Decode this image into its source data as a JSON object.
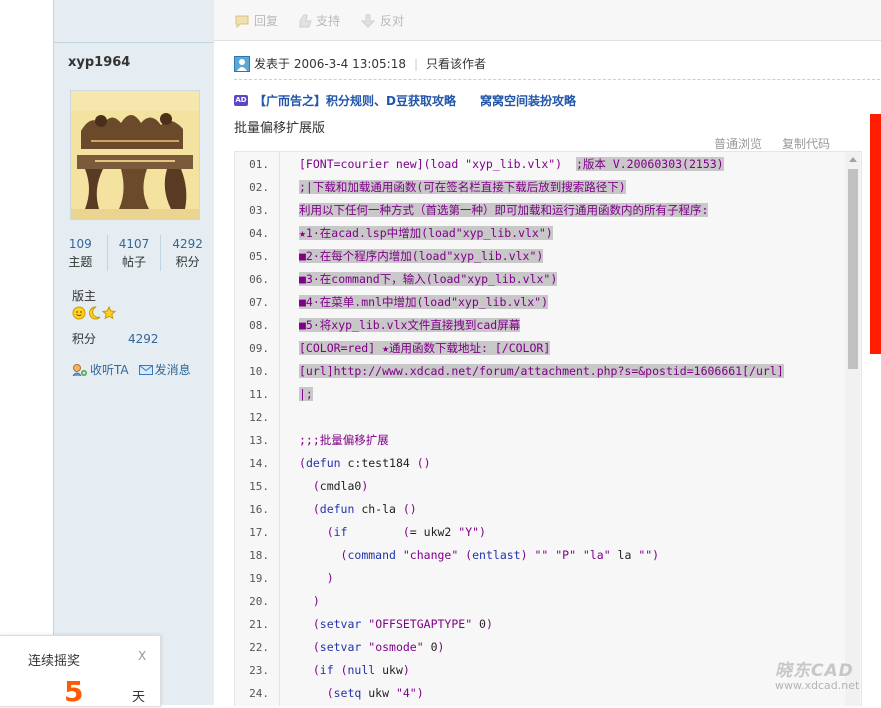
{
  "actions": {
    "reply": "回复",
    "support": "支持",
    "oppose": "反对"
  },
  "user": {
    "name": "xyp1964",
    "stats": [
      {
        "num": "109",
        "label": "主题"
      },
      {
        "num": "4107",
        "label": "帖子"
      },
      {
        "num": "4292",
        "label": "积分"
      }
    ],
    "rank": "版主",
    "credit_label": "积分",
    "credit_value": "4292",
    "listen": "收听TA",
    "message": "发消息"
  },
  "post": {
    "posted": "发表于 2006-3-4 13:05:18",
    "only_author": "只看该作者",
    "ad_badge": "AD",
    "ad_link1": "【广而告之】积分规则、D豆获取攻略",
    "ad_link2": "窝窝空间装扮攻略",
    "title": "批量偏移扩展版"
  },
  "code": {
    "view_plain": "普通浏览",
    "copy_code": "复制代码",
    "lines": [
      {
        "n": "01.",
        "segs": [
          {
            "t": "[FONT=courier new](load \"xyp_lib.vlx\")",
            "c": "purple"
          },
          {
            "t": "  ",
            "c": "black"
          },
          {
            "t": ";版本 V.20060303(2153)",
            "c": "purple",
            "hl": true
          }
        ]
      },
      {
        "n": "02.",
        "segs": [
          {
            "t": ";|下载和加载通用函数(可在签名栏直接下载后放到搜索路径下)",
            "c": "purple",
            "hl": true
          }
        ]
      },
      {
        "n": "03.",
        "segs": [
          {
            "t": "利用以下任何一种方式（首选第一种）即可加载和运行通用函数内的所有子程序:",
            "c": "purple",
            "hl": true
          }
        ]
      },
      {
        "n": "04.",
        "segs": [
          {
            "t": "★1·在acad.lsp中增加(load\"xyp_lib.vlx\")",
            "c": "purple",
            "hl": true
          }
        ]
      },
      {
        "n": "05.",
        "segs": [
          {
            "t": "■2·在每个程序内增加(load\"xyp_lib.vlx\")",
            "c": "purple",
            "hl": true
          }
        ]
      },
      {
        "n": "06.",
        "segs": [
          {
            "t": "■3·在command下，输入(load\"xyp_lib.vlx\")",
            "c": "purple",
            "hl": true
          }
        ]
      },
      {
        "n": "07.",
        "segs": [
          {
            "t": "■4·在菜单.mnl中增加(load\"xyp_lib.vlx\")",
            "c": "purple",
            "hl": true
          }
        ]
      },
      {
        "n": "08.",
        "segs": [
          {
            "t": "■5·将xyp_lib.vlx文件直接拽到cad屏幕",
            "c": "purple",
            "hl": true
          }
        ]
      },
      {
        "n": "09.",
        "segs": [
          {
            "t": "[COLOR=red] ★通用函数下载地址: [/COLOR]",
            "c": "purple",
            "hl": true
          }
        ]
      },
      {
        "n": "10.",
        "segs": [
          {
            "t": "[url]http://www.xdcad.net/forum/attachment.php?s=&postid=1606661[/url]",
            "c": "purple",
            "hl": true
          }
        ]
      },
      {
        "n": "11.",
        "segs": [
          {
            "t": "|;",
            "c": "purple",
            "hl": true
          }
        ]
      },
      {
        "n": "12.",
        "segs": []
      },
      {
        "n": "13.",
        "segs": [
          {
            "t": ";;;批量偏移扩展",
            "c": "purple"
          }
        ]
      },
      {
        "n": "14.",
        "segs": [
          {
            "t": "(",
            "c": "purple"
          },
          {
            "t": "defun",
            "c": "blue"
          },
          {
            "t": " c:test184 ",
            "c": "black"
          },
          {
            "t": "()",
            "c": "purple"
          }
        ]
      },
      {
        "n": "15.",
        "segs": [
          {
            "t": "  (",
            "c": "purple"
          },
          {
            "t": "cmdla0",
            "c": "black"
          },
          {
            "t": ")",
            "c": "purple"
          }
        ]
      },
      {
        "n": "16.",
        "segs": [
          {
            "t": "  (",
            "c": "purple"
          },
          {
            "t": "defun",
            "c": "blue"
          },
          {
            "t": " ch-la ",
            "c": "black"
          },
          {
            "t": "()",
            "c": "purple"
          }
        ]
      },
      {
        "n": "17.",
        "segs": [
          {
            "t": "    (",
            "c": "purple"
          },
          {
            "t": "if",
            "c": "blue"
          },
          {
            "t": "        (",
            "c": "purple"
          },
          {
            "t": "= ukw2 ",
            "c": "black"
          },
          {
            "t": "\"Y\"",
            "c": "purple"
          },
          {
            "t": ")",
            "c": "purple"
          }
        ]
      },
      {
        "n": "18.",
        "segs": [
          {
            "t": "      (",
            "c": "purple"
          },
          {
            "t": "command",
            "c": "blue"
          },
          {
            "t": " ",
            "c": "black"
          },
          {
            "t": "\"change\"",
            "c": "purple"
          },
          {
            "t": " (",
            "c": "purple"
          },
          {
            "t": "entlast",
            "c": "blue"
          },
          {
            "t": ") ",
            "c": "purple"
          },
          {
            "t": "\"\" \"P\" \"la\"",
            "c": "purple"
          },
          {
            "t": " la ",
            "c": "black"
          },
          {
            "t": "\"\")",
            "c": "purple"
          }
        ]
      },
      {
        "n": "19.",
        "segs": [
          {
            "t": "    )",
            "c": "purple"
          }
        ]
      },
      {
        "n": "20.",
        "segs": [
          {
            "t": "  )",
            "c": "purple"
          }
        ]
      },
      {
        "n": "21.",
        "segs": [
          {
            "t": "  (",
            "c": "purple"
          },
          {
            "t": "setvar",
            "c": "blue"
          },
          {
            "t": " ",
            "c": "black"
          },
          {
            "t": "\"OFFSETGAPTYPE\"",
            "c": "purple"
          },
          {
            "t": " 0",
            "c": "black"
          },
          {
            "t": ")",
            "c": "purple"
          }
        ]
      },
      {
        "n": "22.",
        "segs": [
          {
            "t": "  (",
            "c": "purple"
          },
          {
            "t": "setvar",
            "c": "blue"
          },
          {
            "t": " ",
            "c": "black"
          },
          {
            "t": "\"osmode\"",
            "c": "purple"
          },
          {
            "t": " 0",
            "c": "black"
          },
          {
            "t": ")",
            "c": "purple"
          }
        ]
      },
      {
        "n": "23.",
        "segs": [
          {
            "t": "  (",
            "c": "purple"
          },
          {
            "t": "if",
            "c": "blue"
          },
          {
            "t": " (",
            "c": "purple"
          },
          {
            "t": "null",
            "c": "blue"
          },
          {
            "t": " ukw",
            "c": "black"
          },
          {
            "t": ")",
            "c": "purple"
          }
        ]
      },
      {
        "n": "24.",
        "segs": [
          {
            "t": "    (",
            "c": "purple"
          },
          {
            "t": "setq",
            "c": "blue"
          },
          {
            "t": " ukw ",
            "c": "black"
          },
          {
            "t": "\"4\"",
            "c": "purple"
          },
          {
            "t": ")",
            "c": "purple"
          }
        ]
      }
    ]
  },
  "toast": {
    "title": "连续摇奖",
    "close": "X",
    "count": "5",
    "unit": "天"
  },
  "watermark": {
    "main": "晓东CAD",
    "sub": "www.xdcad.net"
  }
}
